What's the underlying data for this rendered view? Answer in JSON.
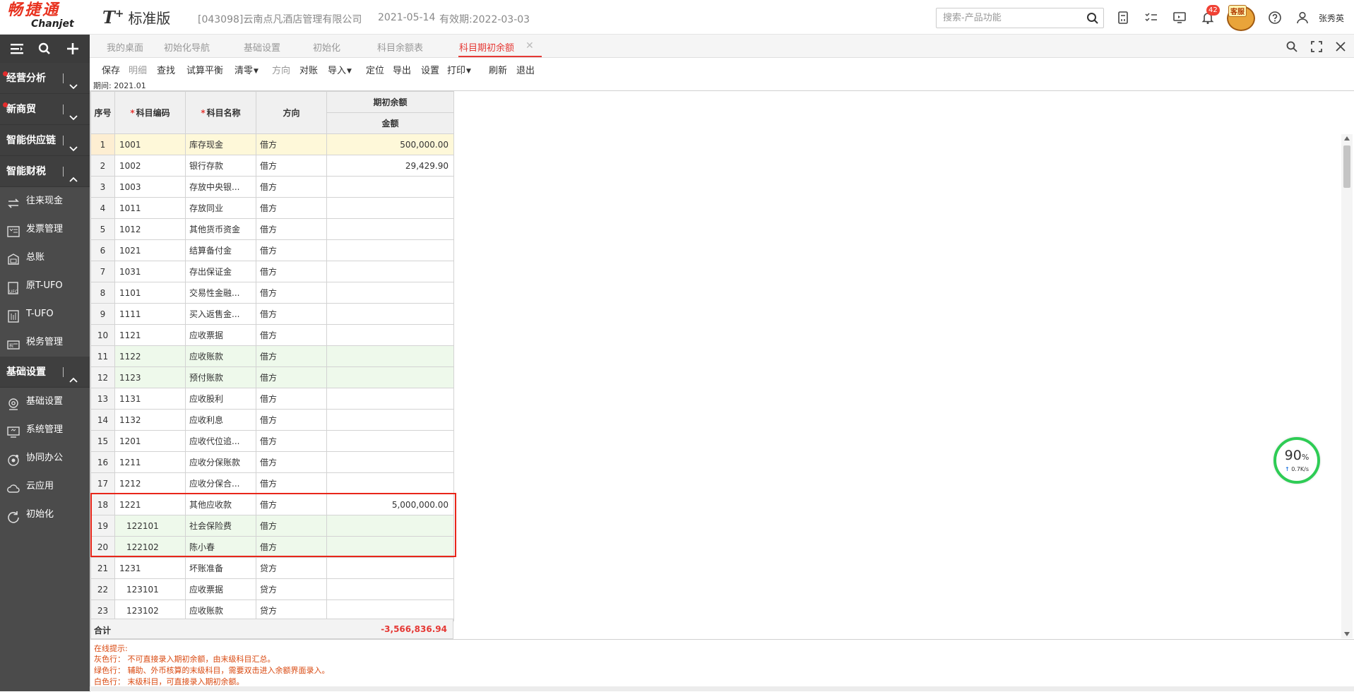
{
  "header": {
    "logo_cn": "畅捷通",
    "logo_en": "Chanjet",
    "product_name": "T",
    "product_plus": "+",
    "edition": "标准版",
    "company": "[043098]云南点凡酒店管理有限公司",
    "date": "2021-05-14",
    "validity": "有效期:2022-03-03",
    "search_placeholder": "搜索-产品功能",
    "notification_count": "42",
    "mascot_label": "客服",
    "username": "张秀英"
  },
  "sidebar": {
    "sections": [
      {
        "label": "经营分析",
        "dot": true,
        "expanded": false
      },
      {
        "label": "新商贸",
        "dot": true,
        "expanded": false
      },
      {
        "label": "智能供应链",
        "dot": false,
        "expanded": false
      },
      {
        "label": "智能财税",
        "dot": false,
        "expanded": true
      }
    ],
    "finance_items": [
      {
        "label": "往来现金",
        "icon": "exchange-icon"
      },
      {
        "label": "发票管理",
        "icon": "invoice-icon"
      },
      {
        "label": "总账",
        "icon": "ledger-icon"
      },
      {
        "label": "原T-UFO",
        "icon": "ufo-icon"
      },
      {
        "label": "T-UFO",
        "icon": "report-icon"
      },
      {
        "label": "税务管理",
        "icon": "tax-icon"
      }
    ],
    "basic_section": {
      "label": "基础设置",
      "expanded": true
    },
    "basic_items": [
      {
        "label": "基础设置",
        "icon": "settings-icon"
      },
      {
        "label": "系统管理",
        "icon": "system-icon"
      },
      {
        "label": "协同办公",
        "icon": "collab-icon"
      },
      {
        "label": "云应用",
        "icon": "cloud-icon"
      },
      {
        "label": "初始化",
        "icon": "init-icon"
      }
    ]
  },
  "tabs": [
    {
      "label": "我的桌面",
      "active": false
    },
    {
      "label": "初始化导航",
      "active": false
    },
    {
      "label": "基础设置",
      "active": false
    },
    {
      "label": "初始化",
      "active": false
    },
    {
      "label": "科目余额表",
      "active": false
    },
    {
      "label": "科目期初余额",
      "active": true
    }
  ],
  "toolbar": [
    {
      "label": "保存",
      "enabled": true,
      "dropdown": false
    },
    {
      "label": "明细",
      "enabled": false,
      "dropdown": false
    },
    {
      "label": "查找",
      "enabled": true,
      "dropdown": false
    },
    {
      "label": "试算平衡",
      "enabled": true,
      "dropdown": false
    },
    {
      "label": "清零",
      "enabled": true,
      "dropdown": true
    },
    {
      "label": "方向",
      "enabled": false,
      "dropdown": false
    },
    {
      "label": "对账",
      "enabled": true,
      "dropdown": false
    },
    {
      "label": "导入",
      "enabled": true,
      "dropdown": true
    },
    {
      "label": "定位",
      "enabled": true,
      "dropdown": false
    },
    {
      "label": "导出",
      "enabled": true,
      "dropdown": false
    },
    {
      "label": "设置",
      "enabled": true,
      "dropdown": false
    },
    {
      "label": "打印",
      "enabled": true,
      "dropdown": true
    },
    {
      "label": "刷新",
      "enabled": true,
      "dropdown": false
    },
    {
      "label": "退出",
      "enabled": true,
      "dropdown": false
    }
  ],
  "period": "期间: 2021.01",
  "grid": {
    "headers": {
      "no": "序号",
      "code": "科目编码",
      "name": "科目名称",
      "direction": "方向",
      "opening": "期初余额",
      "amount": "金额"
    },
    "rows": [
      {
        "no": "1",
        "code": "1001",
        "name": "库存现金",
        "dir": "借方",
        "amount": "500,000.00",
        "color": "yellow",
        "sub": false
      },
      {
        "no": "2",
        "code": "1002",
        "name": "银行存款",
        "dir": "借方",
        "amount": "29,429.90",
        "color": "white",
        "sub": false
      },
      {
        "no": "3",
        "code": "1003",
        "name": "存放中央银...",
        "dir": "借方",
        "amount": "",
        "color": "white",
        "sub": false
      },
      {
        "no": "4",
        "code": "1011",
        "name": "存放同业",
        "dir": "借方",
        "amount": "",
        "color": "white",
        "sub": false
      },
      {
        "no": "5",
        "code": "1012",
        "name": "其他货币资金",
        "dir": "借方",
        "amount": "",
        "color": "white",
        "sub": false
      },
      {
        "no": "6",
        "code": "1021",
        "name": "结算备付金",
        "dir": "借方",
        "amount": "",
        "color": "white",
        "sub": false
      },
      {
        "no": "7",
        "code": "1031",
        "name": "存出保证金",
        "dir": "借方",
        "amount": "",
        "color": "white",
        "sub": false
      },
      {
        "no": "8",
        "code": "1101",
        "name": "交易性金融...",
        "dir": "借方",
        "amount": "",
        "color": "white",
        "sub": false
      },
      {
        "no": "9",
        "code": "1111",
        "name": "买入返售金...",
        "dir": "借方",
        "amount": "",
        "color": "white",
        "sub": false
      },
      {
        "no": "10",
        "code": "1121",
        "name": "应收票据",
        "dir": "借方",
        "amount": "",
        "color": "white",
        "sub": false
      },
      {
        "no": "11",
        "code": "1122",
        "name": "应收账款",
        "dir": "借方",
        "amount": "",
        "color": "green",
        "sub": false
      },
      {
        "no": "12",
        "code": "1123",
        "name": "预付账款",
        "dir": "借方",
        "amount": "",
        "color": "green",
        "sub": false
      },
      {
        "no": "13",
        "code": "1131",
        "name": "应收股利",
        "dir": "借方",
        "amount": "",
        "color": "white",
        "sub": false
      },
      {
        "no": "14",
        "code": "1132",
        "name": "应收利息",
        "dir": "借方",
        "amount": "",
        "color": "white",
        "sub": false
      },
      {
        "no": "15",
        "code": "1201",
        "name": "应收代位追...",
        "dir": "借方",
        "amount": "",
        "color": "white",
        "sub": false
      },
      {
        "no": "16",
        "code": "1211",
        "name": "应收分保账款",
        "dir": "借方",
        "amount": "",
        "color": "white",
        "sub": false
      },
      {
        "no": "17",
        "code": "1212",
        "name": "应收分保合...",
        "dir": "借方",
        "amount": "",
        "color": "white",
        "sub": false
      },
      {
        "no": "18",
        "code": "1221",
        "name": "其他应收款",
        "dir": "借方",
        "amount": "5,000,000.00",
        "color": "white",
        "sub": false
      },
      {
        "no": "19",
        "code": "122101",
        "name": "社会保险费",
        "dir": "借方",
        "amount": "",
        "color": "green",
        "sub": true
      },
      {
        "no": "20",
        "code": "122102",
        "name": "陈小春",
        "dir": "借方",
        "amount": "",
        "color": "green",
        "sub": true
      },
      {
        "no": "21",
        "code": "1231",
        "name": "坏账准备",
        "dir": "贷方",
        "amount": "",
        "color": "white",
        "sub": false
      },
      {
        "no": "22",
        "code": "123101",
        "name": "应收票据",
        "dir": "贷方",
        "amount": "",
        "color": "white",
        "sub": true
      },
      {
        "no": "23",
        "code": "123102",
        "name": "应收账款",
        "dir": "贷方",
        "amount": "",
        "color": "white",
        "sub": true
      }
    ],
    "total_label": "合计",
    "total_value": "-3,566,836.94"
  },
  "hints": {
    "title": "在线提示:",
    "lines": [
      "灰色行： 不可直接录入期初余额，由末级科目汇总。",
      "绿色行： 辅助、外币核算的末级科目，需要双击进入余额界面录入。",
      "白色行： 末级科目，可直接录入期初余额。"
    ]
  },
  "gauge": {
    "percent": "90",
    "percent_unit": "%",
    "speed": "0.7K/s"
  },
  "colors": {
    "accent": "#e53935",
    "sidebar": "#4b4b4b",
    "green_row": "#eef9eb",
    "yellow_row": "#fef8d9",
    "highlight": "#e8261a"
  }
}
